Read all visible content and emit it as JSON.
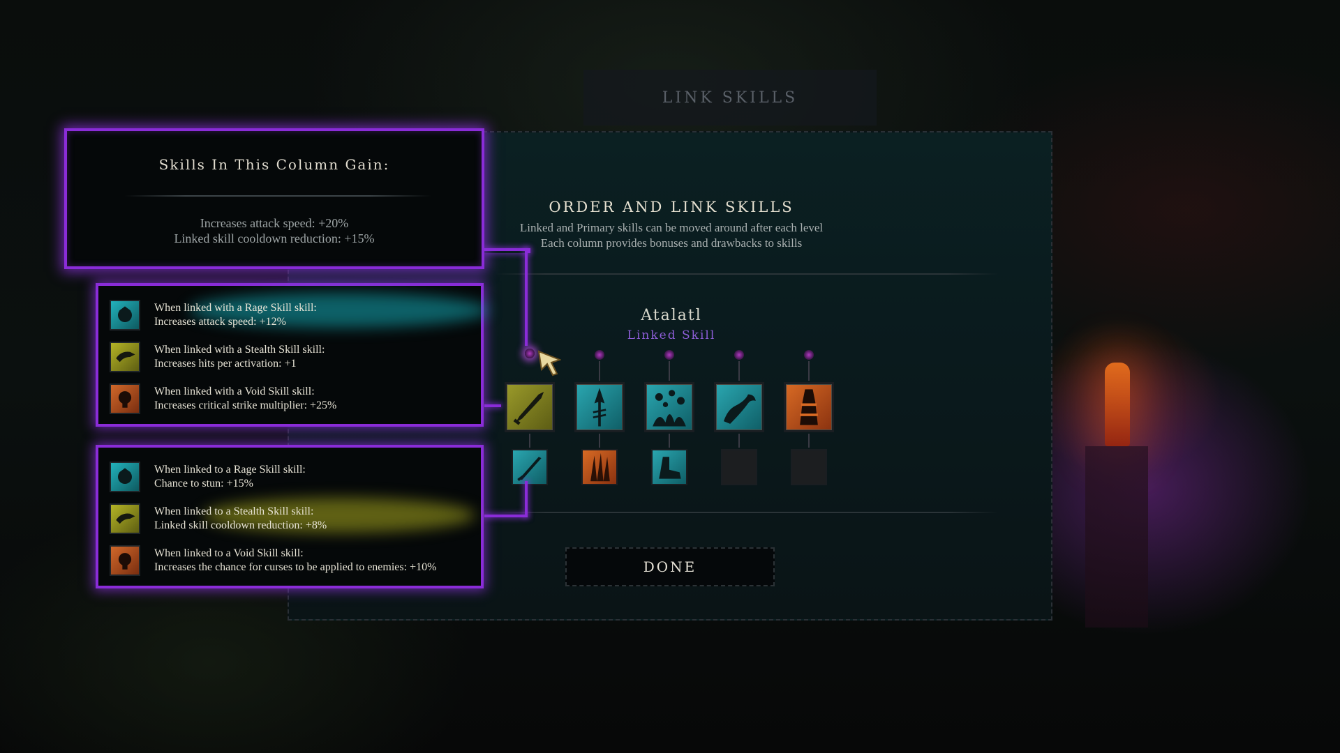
{
  "header": {
    "title": "LINK SKILLS"
  },
  "main": {
    "title": "ORDER AND LINK SKILLS",
    "subtitle_1": "Linked and Primary skills can be moved around after each level",
    "subtitle_2": "Each column provides bonuses and drawbacks to skills"
  },
  "selected_skill": {
    "name": "Atalatl",
    "type": "Linked Skill"
  },
  "column_bonus": {
    "title": "Skills In This Column Gain:",
    "lines": [
      "Increases attack speed: +20%",
      "Linked skill cooldown reduction: +15%"
    ]
  },
  "linked_with": [
    {
      "icon": "rage-icon",
      "line1": "When linked with a Rage Skill skill:",
      "line2": "Increases attack speed: +12%"
    },
    {
      "icon": "stealth-icon",
      "line1": "When linked with a Stealth Skill skill:",
      "line2": "Increases hits per activation: +1"
    },
    {
      "icon": "void-icon",
      "line1": "When linked with a Void Skill skill:",
      "line2": "Increases critical strike multiplier: +25%"
    }
  ],
  "linked_to": [
    {
      "icon": "rage-icon",
      "line1": "When linked to a Rage Skill skill:",
      "line2": "Chance to stun: +15%"
    },
    {
      "icon": "stealth-icon",
      "line1": "When linked to a Stealth Skill skill:",
      "line2": "Linked skill cooldown reduction: +8%"
    },
    {
      "icon": "void-icon",
      "line1": "When linked to a Void Skill skill:",
      "line2": "Increases the chance for curses to be applied to enemies: +10%"
    }
  ],
  "primary_slots": [
    {
      "name": "dagger-skill-icon",
      "color": "#8a8a22"
    },
    {
      "name": "spear-skill-icon",
      "color": "#1a8c98"
    },
    {
      "name": "spores-skill-icon",
      "color": "#1a8c98"
    },
    {
      "name": "serpent-skill-icon",
      "color": "#1a8c98"
    },
    {
      "name": "totem-skill-icon",
      "color": "#c85a1e"
    }
  ],
  "linked_slots": [
    {
      "name": "atlatl-skill-icon",
      "color": "#1a8c98",
      "filled": true
    },
    {
      "name": "claw-skill-icon",
      "color": "#c85a1e",
      "filled": true
    },
    {
      "name": "boot-skill-icon",
      "color": "#1a8c98",
      "filled": true
    },
    {
      "name": "empty-slot",
      "color": "#1c1e20",
      "filled": false
    },
    {
      "name": "empty-slot",
      "color": "#1c1e20",
      "filled": false
    }
  ],
  "colors": {
    "rage": "#1aa6b2",
    "stealth": "#a8a81e",
    "void": "#c25a22",
    "highlight": "#8a2cd8",
    "linked_label": "#8e5ed8"
  },
  "done_label": "DONE"
}
